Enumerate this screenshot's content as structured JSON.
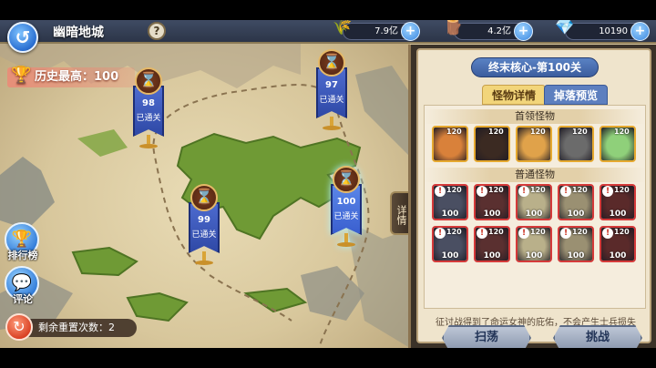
{
  "header": {
    "title": "幽暗地城",
    "help": "?",
    "resources": [
      {
        "icon": "wheat-icon",
        "value": "7.9亿"
      },
      {
        "icon": "wood-icon",
        "value": "4.2亿"
      },
      {
        "icon": "diamond-icon",
        "value": "10190"
      }
    ]
  },
  "record": {
    "label": "历史最高：100"
  },
  "map": {
    "flags": [
      {
        "level": "97",
        "status": "已通关"
      },
      {
        "level": "98",
        "status": "已通关"
      },
      {
        "level": "99",
        "status": "已通关"
      },
      {
        "level": "100",
        "status": "已通关"
      }
    ]
  },
  "side": {
    "leaderboard": "排行榜",
    "comments": "评论",
    "reset_label": "剩余重置次数：2"
  },
  "detail_tab": "详情",
  "panel": {
    "stage_title": "终末核心-第100关",
    "tabs": [
      "怪物详情",
      "掉落预览"
    ],
    "boss_header": "首领怪物",
    "normal_header": "普通怪物",
    "bosses": [
      {
        "level": "120"
      },
      {
        "level": "120"
      },
      {
        "level": "120"
      },
      {
        "level": "120"
      },
      {
        "level": "120"
      }
    ],
    "normals_row1": [
      {
        "level": "120",
        "count": "100"
      },
      {
        "level": "120",
        "count": "100"
      },
      {
        "level": "120",
        "count": "100"
      },
      {
        "level": "120",
        "count": "100"
      },
      {
        "level": "120",
        "count": "100"
      }
    ],
    "normals_row2": [
      {
        "level": "120",
        "count": "100"
      },
      {
        "level": "120",
        "count": "100"
      },
      {
        "level": "120",
        "count": "100"
      },
      {
        "level": "120",
        "count": "100"
      },
      {
        "level": "120",
        "count": "100"
      }
    ],
    "notice": "征讨战得到了命运女神的庇佑，不会产生士兵损失",
    "sweep": "扫荡",
    "challenge": "挑战"
  }
}
